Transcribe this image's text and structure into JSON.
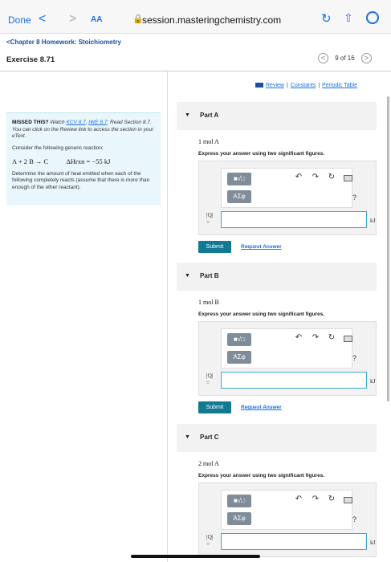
{
  "browser": {
    "done_label": "Done",
    "back_glyph": "<",
    "forward_glyph": ">",
    "text_size_label": "AA",
    "url": "session.masteringchemistry.com"
  },
  "header": {
    "breadcrumb": "<Chapter 8 Homework: Stoichiometry",
    "title": "Exercise 8.71",
    "pager_label": "9 of 16",
    "prev_glyph": "<",
    "next_glyph": ">"
  },
  "info": {
    "missed_bold": "MISSED THIS?",
    "missed_watch": " Watch ",
    "link_kcv": "KCV 8.7",
    "sep1": ", ",
    "link_iwe": "IWE 8.7",
    "missed_rest": "; Read Section 8.7. You can click on the Review link to access the section in your eText.",
    "consider": "Consider the following generic reaction:",
    "equation": "A + 2 B → C",
    "delta_h": "ΔHrxn = −55 kJ",
    "determine": "Determine the amount of heat emitted when each of the following completely reacts (assume that there is more than enough of the other reactant)."
  },
  "links": {
    "review": "Review",
    "sep": "|",
    "constants": "Constants",
    "periodic_table": "Periodic Table"
  },
  "parts": [
    {
      "label": "Part A",
      "quantity": "1 mol A",
      "instruction": "Express your answer using two significant figures.",
      "q_label": "|Q|",
      "eq": "=",
      "unit": "kJ",
      "submit": "Submit",
      "request": "Request Answer",
      "template_glyph": "■√□",
      "greek_glyph": "ΑΣφ",
      "help": "?"
    },
    {
      "label": "Part B",
      "quantity": "1 mol B",
      "instruction": "Express your answer using two significant figures.",
      "q_label": "|Q|",
      "eq": "=",
      "unit": "kJ",
      "submit": "Submit",
      "request": "Request Answer",
      "template_glyph": "■√□",
      "greek_glyph": "ΑΣφ",
      "help": "?"
    },
    {
      "label": "Part C",
      "quantity": "2 mol A",
      "instruction": "Express your answer using two significant figures.",
      "q_label": "|Q|",
      "eq": "=",
      "unit": "kJ",
      "template_glyph": "■√□",
      "greek_glyph": "ΑΣφ",
      "help": "?"
    }
  ]
}
